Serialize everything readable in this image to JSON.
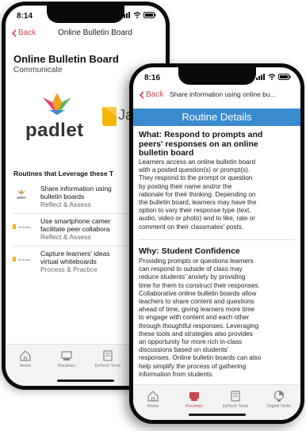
{
  "phone1": {
    "status_time": "8:14",
    "back_label": "Back",
    "nav_title": "Online Bulletin Board",
    "title": "Online Bulletin Board",
    "subtitle": "Communicate",
    "logos": {
      "padlet_text": "padlet",
      "jamboard_partial": "Ja"
    },
    "section_title": "Routines that Leverage these T",
    "routines": [
      {
        "line1": "Share information using",
        "line2": "bulletin boards",
        "category": "Reflect & Assess",
        "icon": "padlet-logo"
      },
      {
        "line1": "Use smartphone camer",
        "line2": "facilitate peer collabora",
        "category": "Reflect & Assess",
        "icon": "jamboard-logo"
      },
      {
        "line1": "Capture learners' ideas",
        "line2": "virtual whiteboards",
        "category": "Process & Practice",
        "icon": "jamboard-logo"
      }
    ],
    "tabs": [
      {
        "label": "Home",
        "icon": "home-icon"
      },
      {
        "label": "Routines",
        "icon": "routines-icon"
      },
      {
        "label": "EdTech Tools",
        "icon": "edtech-tools-icon"
      }
    ]
  },
  "phone2": {
    "status_time": "8:16",
    "back_label": "Back",
    "nav_title": "Share information using online bu...",
    "header": "Routine Details",
    "what_heading": [
      "What: Respond to prompts and",
      "peers' responses on an online",
      "bulletin board"
    ],
    "what_body": [
      "Learners access an online bulletin board",
      "with a posted question(s) or prompt(s).",
      "They respond to the prompt or question",
      "by posting their name and/or the",
      "rationale for their thinking. Depending on",
      "the bulletin board, learners may have the",
      "option to vary their response type (text,",
      "audio, video or photo) and to like, rate or",
      "comment on their classmates' posts."
    ],
    "why_heading": "Why: Student Confidence",
    "why_body": [
      "Providing prompts or questions learners",
      "can respond to outside of class may",
      "reduce students' anxiety by providing",
      "time for them to construct their responses.",
      "Collaborative online bulletin boards allow",
      "teachers to share content and questions",
      "ahead of time, giving learners more time",
      "to engage with content and each other",
      "through thoughtful responses. Leveraging",
      "these tools and strategies also provides",
      "an opportunity for more rich in-class",
      "discussions based on students'",
      "responses. Online bulletin boards can also",
      "help simplify the process of gathering",
      "information from students."
    ],
    "tabs": [
      {
        "label": "Home",
        "icon": "home-icon"
      },
      {
        "label": "Routines",
        "icon": "routines-icon"
      },
      {
        "label": "EdTech Tools",
        "icon": "edtech-tools-icon"
      },
      {
        "label": "Digital Skills",
        "icon": "digital-skills-icon"
      }
    ]
  },
  "colors": {
    "accent": "#c8484f",
    "header_blue": "#3a8bd0",
    "padlet_pink": "#e0457b",
    "padlet_green": "#5bb55a",
    "jamboard_yellow": "#f4b400"
  }
}
